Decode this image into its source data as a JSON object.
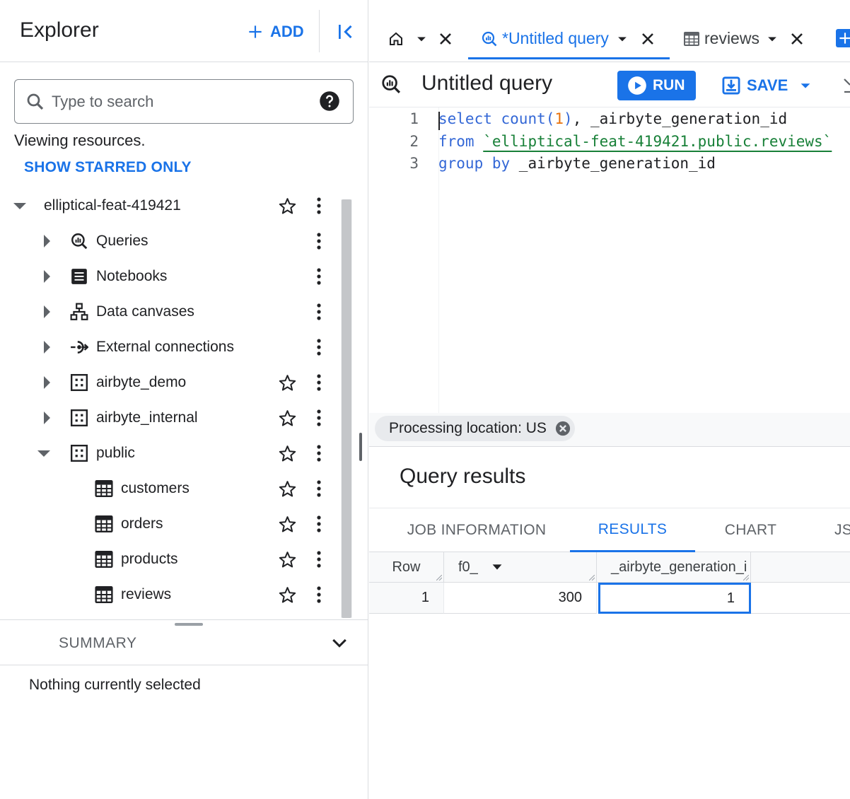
{
  "explorer": {
    "title": "Explorer",
    "add_label": "ADD",
    "search_placeholder": "Type to search",
    "viewing_text": "Viewing resources.",
    "show_starred_label": "SHOW STARRED ONLY",
    "project": "elliptical-feat-419421",
    "items": {
      "queries": "Queries",
      "notebooks": "Notebooks",
      "data_canvases": "Data canvases",
      "external_connections": "External connections",
      "airbyte_demo": "airbyte_demo",
      "airbyte_internal": "airbyte_internal",
      "public": "public",
      "customers": "customers",
      "orders": "orders",
      "products": "products",
      "reviews": "reviews"
    },
    "summary_label": "SUMMARY",
    "nothing_selected": "Nothing currently selected"
  },
  "tabs": {
    "active_label": "*Untitled query",
    "reviews_label": "reviews"
  },
  "query": {
    "title": "Untitled query",
    "run_label": "RUN",
    "save_label": "SAVE",
    "line_numbers": [
      "1",
      "2",
      "3"
    ],
    "sql": {
      "l1_kw": "select",
      "l1_fn": "count(",
      "l1_num": "1",
      "l1_close": ")",
      "l1_rest": ", _airbyte_generation_id",
      "l2_kw": "from",
      "l2_str": "`elliptical-feat-419421.public.reviews`",
      "l3_kw": "group by",
      "l3_rest": " _airbyte_generation_id"
    },
    "processing_location": "Processing location: US"
  },
  "results": {
    "title": "Query results",
    "tabs": [
      "JOB INFORMATION",
      "RESULTS",
      "CHART",
      "JS"
    ],
    "columns": [
      "Row",
      "f0_",
      "_airbyte_generation_i"
    ],
    "rows": [
      [
        "1",
        "300",
        "1"
      ]
    ]
  },
  "colors": {
    "accent": "#1a73e8",
    "keyword": "#3367d6",
    "string": "#188038",
    "number": "#e8710a"
  }
}
